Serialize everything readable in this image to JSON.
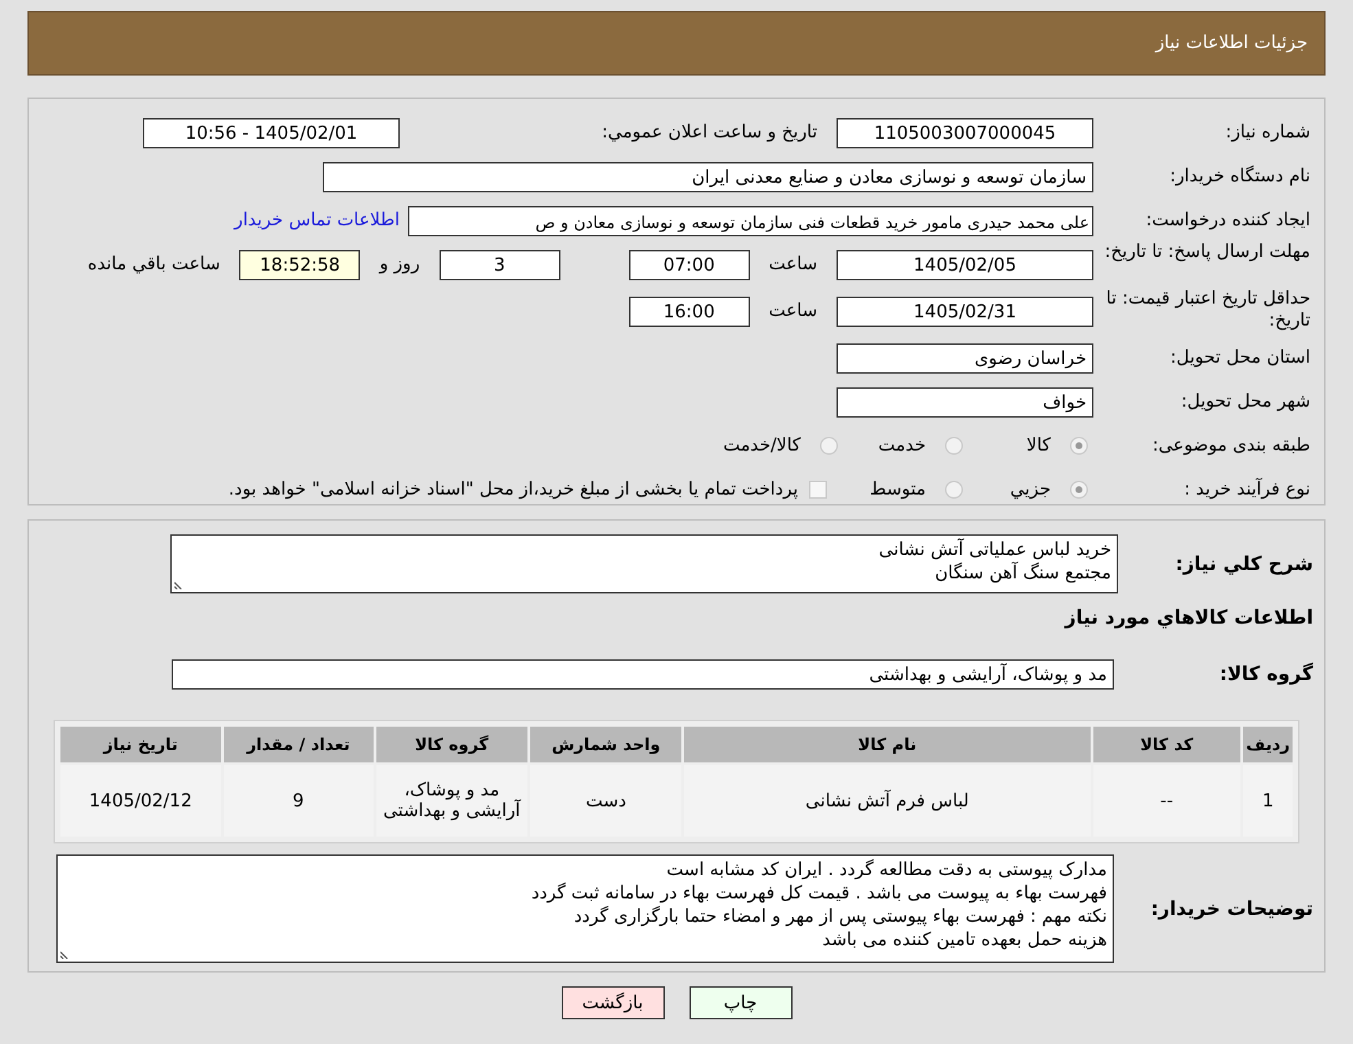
{
  "header": {
    "title": "جزئیات اطلاعات نیاز"
  },
  "need_number": {
    "label": "شماره نیاز:",
    "value": "1105003007000045"
  },
  "announce": {
    "label": "تاریخ و ساعت اعلان عمومي:",
    "value": "1405/02/01 - 10:56"
  },
  "buyer": {
    "label": "نام دستگاه خریدار:",
    "value": "سازمان توسعه و نوسازی معادن و صنایع معدنی ایران"
  },
  "requester": {
    "label": "ایجاد کننده درخواست:",
    "value": "علی محمد حیدری مامور خرید قطعات فنی سازمان توسعه و نوسازی معادن و ص",
    "link": "اطلاعات تماس خریدار"
  },
  "deadline": {
    "label": "مهلت ارسال پاسخ: تا تاریخ:",
    "date": "1405/02/05",
    "time_label": "ساعت",
    "time": "07:00",
    "days": "3",
    "days_label": "روز و",
    "remaining": "18:52:58",
    "remaining_label": "ساعت باقي مانده"
  },
  "validity": {
    "label": "حداقل تاریخ اعتبار قیمت: تا تاریخ:",
    "date": "1405/02/31",
    "time_label": "ساعت",
    "time": "16:00"
  },
  "province": {
    "label": "استان محل تحویل:",
    "value": "خراسان رضوی"
  },
  "city": {
    "label": "شهر محل تحویل:",
    "value": "خواف"
  },
  "category": {
    "label": "طبقه بندی موضوعی:",
    "options": [
      {
        "label": "کالا",
        "selected": true
      },
      {
        "label": "خدمت",
        "selected": false
      },
      {
        "label": "کالا/خدمت",
        "selected": false
      }
    ]
  },
  "purchase_type": {
    "label": "نوع فرآیند خرید :",
    "options": [
      {
        "label": "جزيي",
        "selected": true
      },
      {
        "label": "متوسط",
        "selected": false
      }
    ],
    "checked": false,
    "note": "پرداخت تمام یا بخشی از مبلغ خرید،از محل \"اسناد خزانه اسلامی\" خواهد بود."
  },
  "summary": {
    "label": "شرح کلي نياز:",
    "lines": [
      "خرید لباس عملیاتی آتش نشانی",
      "مجتمع سنگ آهن سنگان"
    ]
  },
  "goods_title": "اطلاعات کالاهاي مورد نياز",
  "goods_group": {
    "label": "گروه کالا:",
    "value": "مد و پوشاک، آرایشی و بهداشتی"
  },
  "table": {
    "columns": [
      "رديف",
      "کد کالا",
      "نام کالا",
      "واحد شمارش",
      "گروه کالا",
      "تعداد / مقدار",
      "تاریخ نیاز"
    ],
    "rows": [
      [
        "1",
        "--",
        "لباس فرم آتش نشانی",
        "دست",
        "مد و پوشاک، آرایشی و بهداشتی",
        "9",
        "1405/02/12"
      ]
    ]
  },
  "buyer_notes": {
    "label": "توضیحات خریدار:",
    "lines": [
      "مدارک پیوستی به دقت مطالعه گردد . ایران کد مشابه است",
      "فهرست بهاء به پیوست می باشد . قیمت کل فهرست بهاء در سامانه ثبت گردد",
      "نکته مهم : فهرست بهاء پیوستی پس از مهر و امضاء حتما بارگزاری گردد",
      "هزینه حمل بعهده تامین کننده می باشد"
    ]
  },
  "buttons": [
    {
      "kind": "print",
      "label": "چاپ"
    },
    {
      "kind": "back",
      "label": "بازگشت"
    }
  ]
}
